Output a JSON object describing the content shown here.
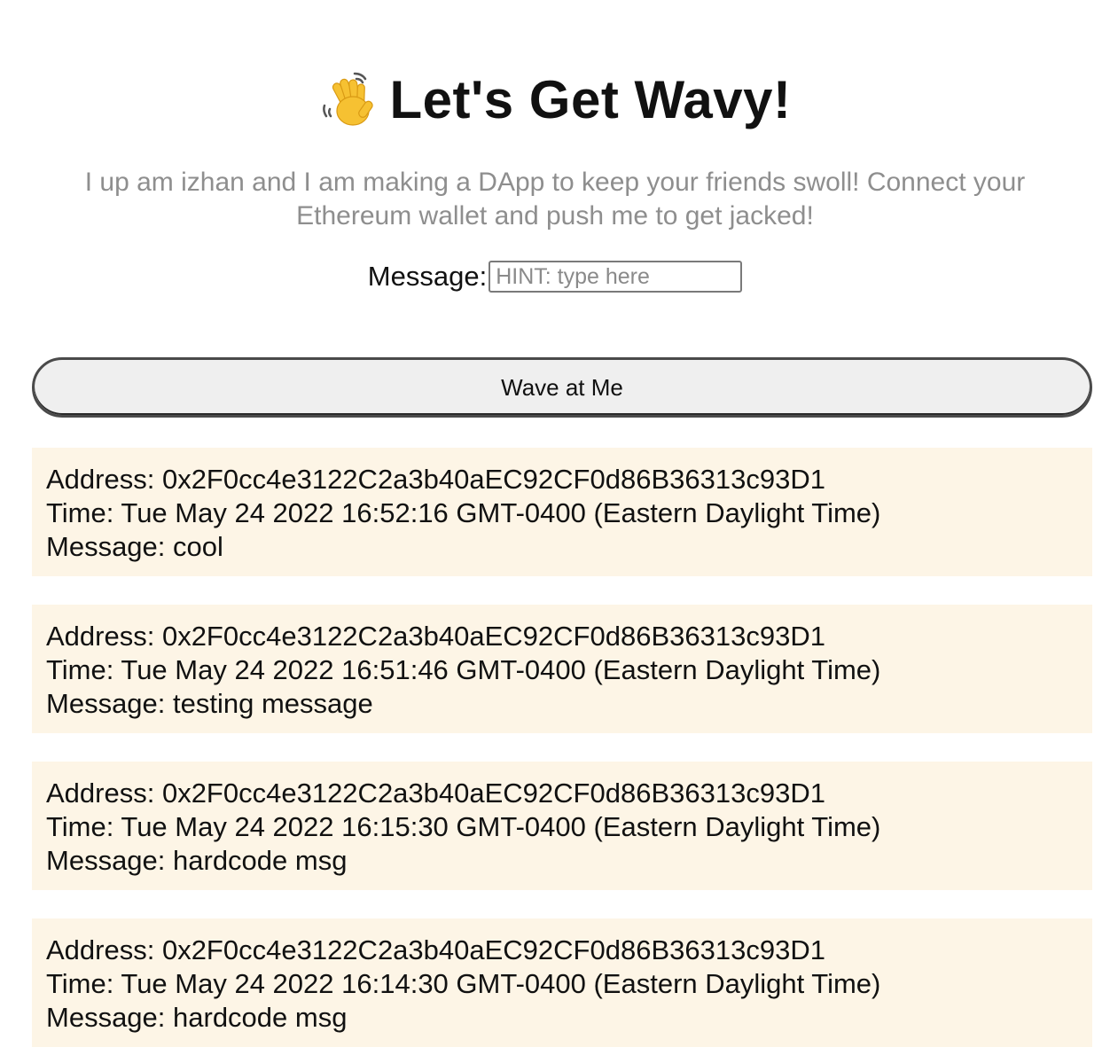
{
  "header": {
    "icon": "waving-hand-icon",
    "title": "Let's Get Wavy!"
  },
  "subtitle": "I up am izhan and I am making a DApp to keep your friends swoll! Connect your Ethereum wallet and push me to get jacked!",
  "message_form": {
    "label": "Message:",
    "placeholder": "HINT: type here",
    "value": ""
  },
  "wave_button": {
    "label": "Wave at Me"
  },
  "colors": {
    "card_background": "#fdf5e6",
    "subtitle": "#8e8e8e",
    "button_background": "#efefef"
  },
  "waves": [
    {
      "address": "Address: 0x2F0cc4e3122C2a3b40aEC92CF0d86B36313c93D1",
      "time": "Time: Tue May 24 2022 16:52:16 GMT-0400 (Eastern Daylight Time)",
      "message": "Message: cool"
    },
    {
      "address": "Address: 0x2F0cc4e3122C2a3b40aEC92CF0d86B36313c93D1",
      "time": "Time: Tue May 24 2022 16:51:46 GMT-0400 (Eastern Daylight Time)",
      "message": "Message: testing message"
    },
    {
      "address": "Address: 0x2F0cc4e3122C2a3b40aEC92CF0d86B36313c93D1",
      "time": "Time: Tue May 24 2022 16:15:30 GMT-0400 (Eastern Daylight Time)",
      "message": "Message: hardcode msg"
    },
    {
      "address": "Address: 0x2F0cc4e3122C2a3b40aEC92CF0d86B36313c93D1",
      "time": "Time: Tue May 24 2022 16:14:30 GMT-0400 (Eastern Daylight Time)",
      "message": "Message: hardcode msg"
    }
  ]
}
